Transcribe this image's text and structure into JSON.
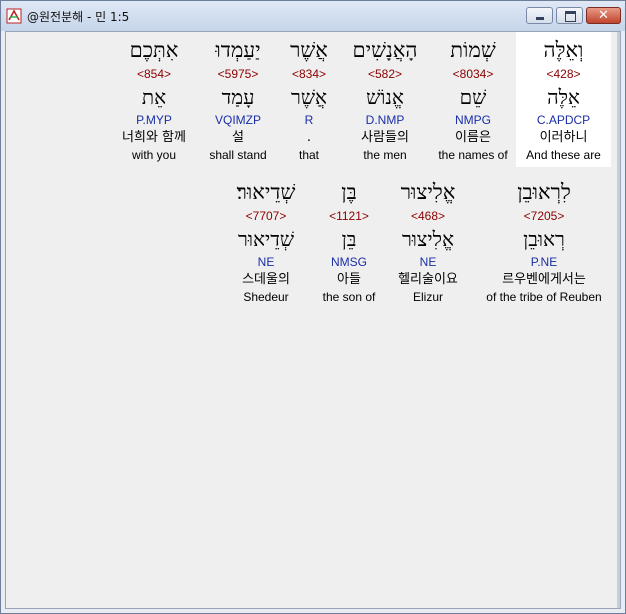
{
  "window": {
    "title": "@원전분해 - 민 1:5",
    "buttons": {
      "minimize": "minimize",
      "maximize": "maximize",
      "close": "✕"
    }
  },
  "rows": [
    {
      "words": [
        {
          "hebrew": "וְאֵלֶּה",
          "strong": "<428>",
          "root": "אֵלֶּה",
          "parse": "C.APDCP",
          "korean": "이러하니",
          "english": "And these are",
          "highlight": true
        },
        {
          "hebrew": "שְׁמוֹת",
          "strong": "<8034>",
          "root": "שֵׁם",
          "parse": "NMPG",
          "korean": "이름은",
          "english": "the names of",
          "highlight": false
        },
        {
          "hebrew": "הָאֲנָשִׁים",
          "strong": "<582>",
          "root": "אֱנוֹשׁ",
          "parse": "D.NMP",
          "korean": "사람들의",
          "english": "the men",
          "highlight": false
        },
        {
          "hebrew": "אֲשֶׁר",
          "strong": "<834>",
          "root": "אֲשֶׁר",
          "parse": "R",
          "korean": ".",
          "english": "that",
          "highlight": false
        },
        {
          "hebrew": "יַעַמְדוּ",
          "strong": "<5975>",
          "root": "עָמַד",
          "parse": "VQIMZP",
          "korean": "설",
          "english": "shall stand",
          "highlight": false
        },
        {
          "hebrew": "אִתְּכֶם",
          "strong": "<854>",
          "root": "אֵת",
          "parse": "P.MYP",
          "korean": "너희와 함께",
          "english": "with you",
          "highlight": false
        }
      ]
    },
    {
      "words": [
        {
          "hebrew": "לִרְאוּבֵן",
          "strong": "<7205>",
          "root": "רְאוּבֵן",
          "parse": "P.NE",
          "korean": "르우벤에게서는",
          "english": "of the tribe of Reuben",
          "highlight": false
        },
        {
          "hebrew": "אֱלִיצוּר",
          "strong": "<468>",
          "root": "אֱלִיצוּר",
          "parse": "NE",
          "korean": "헬리술이요",
          "english": "Elizur",
          "highlight": false
        },
        {
          "hebrew": "בֶּן",
          "strong": "<1121>",
          "root": "בֵּן",
          "parse": "NMSG",
          "korean": "아들",
          "english": "the son of",
          "highlight": false
        },
        {
          "hebrew": "שְׁדֵיאוּר׃",
          "strong": "<7707>",
          "root": "שְׁדֵיאוּר",
          "parse": "NE",
          "korean": "스데울의",
          "english": "Shedeur",
          "highlight": false
        }
      ]
    }
  ],
  "colors": {
    "strong": "#8b0000",
    "parse": "#1a2ea8",
    "highlight_bg": "#ffffff"
  }
}
